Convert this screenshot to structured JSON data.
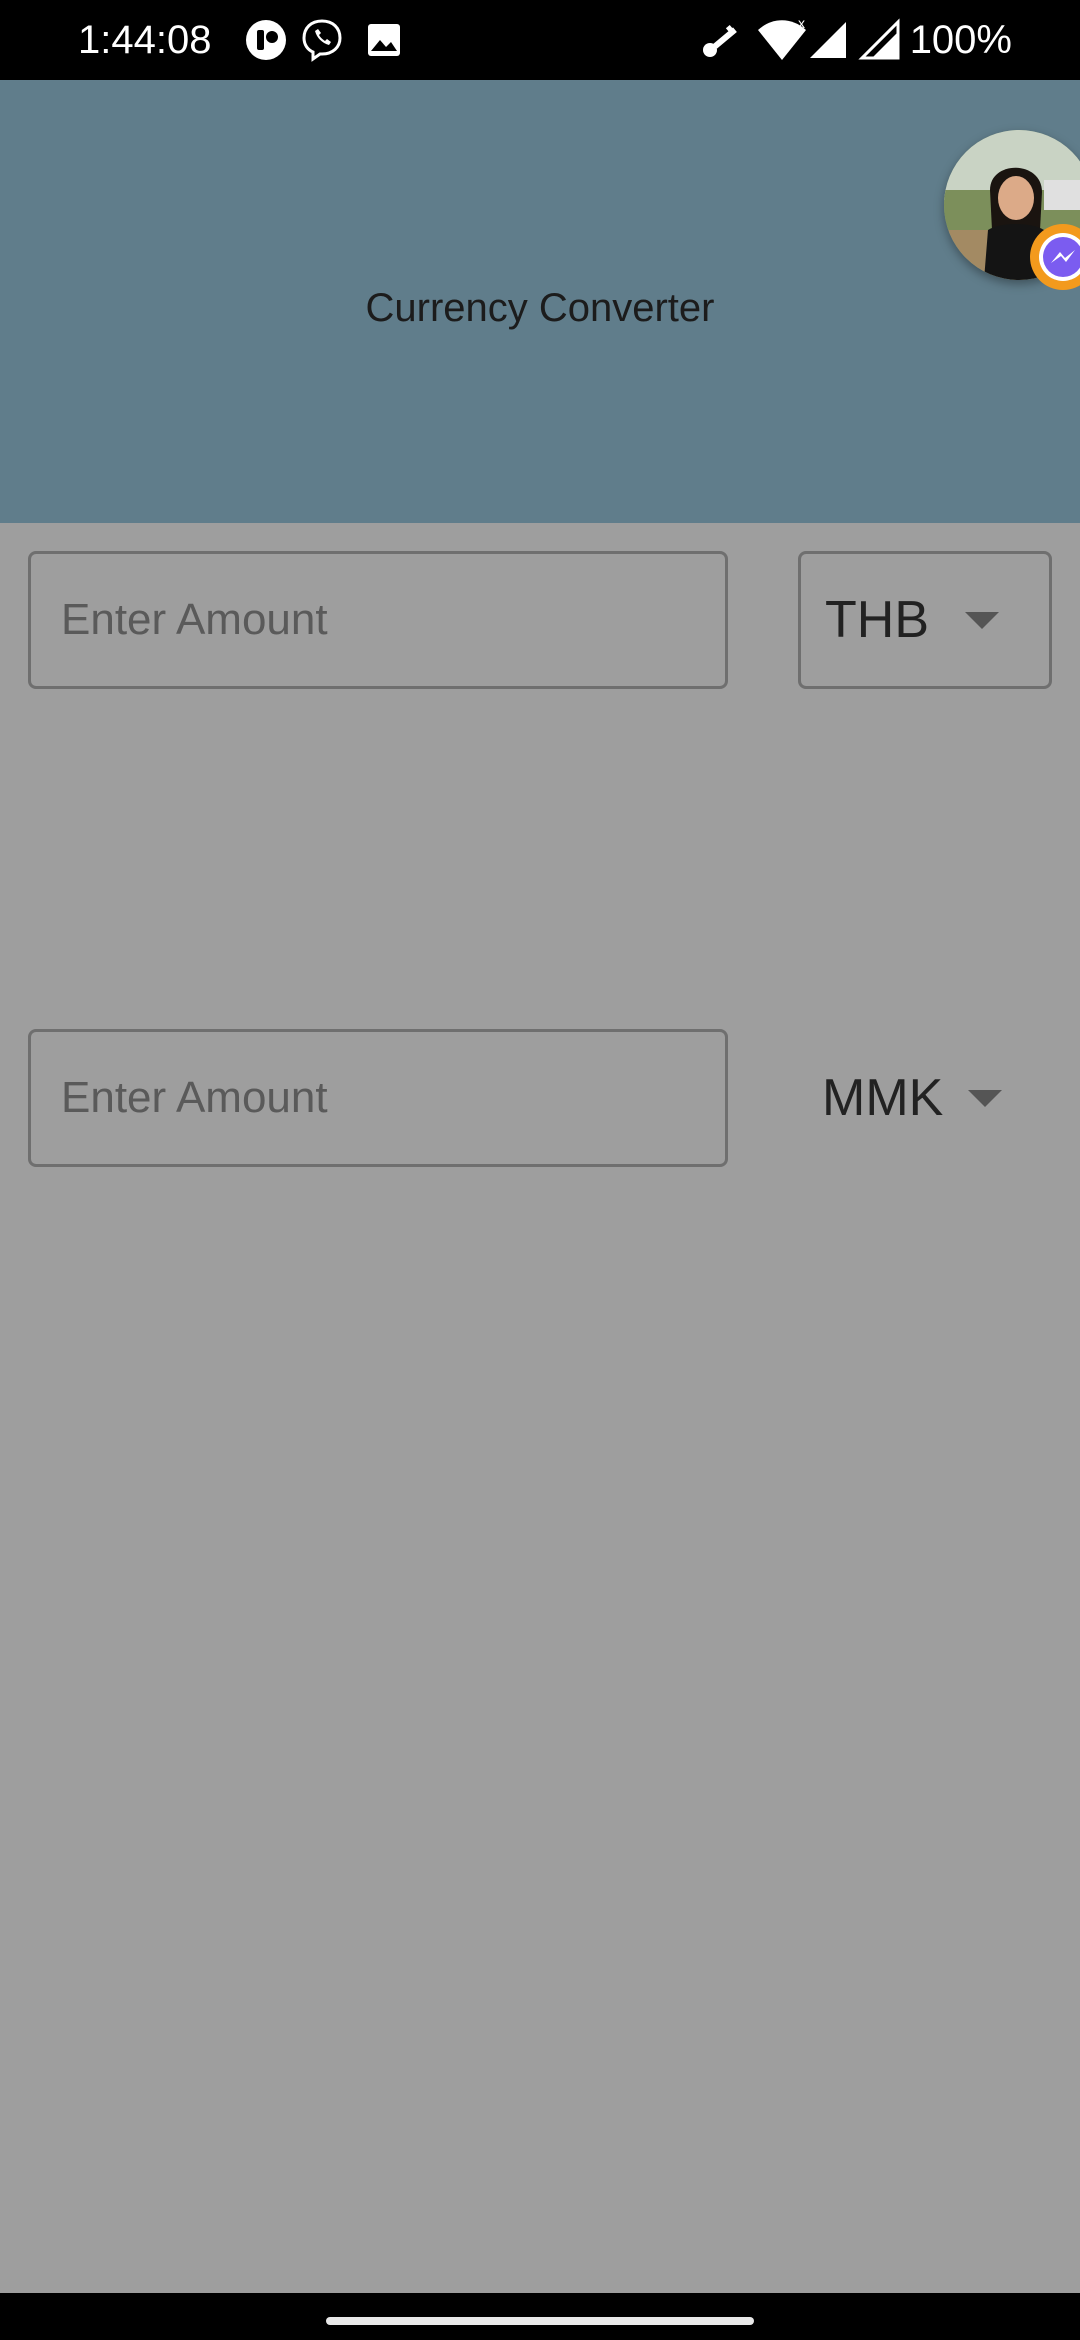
{
  "status_bar": {
    "time": "1:44:08",
    "battery": "100%",
    "left_icons": [
      "app-icon",
      "viber-icon",
      "gallery-icon"
    ],
    "right_icons": [
      "key-icon",
      "wifi-icon",
      "signal-icon",
      "signal-icon"
    ]
  },
  "header": {
    "title": "Currency Converter",
    "background_color": "#607d8b"
  },
  "chat_head": {
    "icon": "messenger-icon",
    "badge_color": "#f39a1d"
  },
  "converter": {
    "from": {
      "amount_placeholder": "Enter Amount",
      "amount_value": "",
      "currency": "THB"
    },
    "to": {
      "amount_placeholder": "Enter Amount",
      "amount_value": "",
      "currency": "MMK"
    }
  },
  "colors": {
    "overlay_background": "#9e9e9e",
    "status_bar": "#000000"
  }
}
